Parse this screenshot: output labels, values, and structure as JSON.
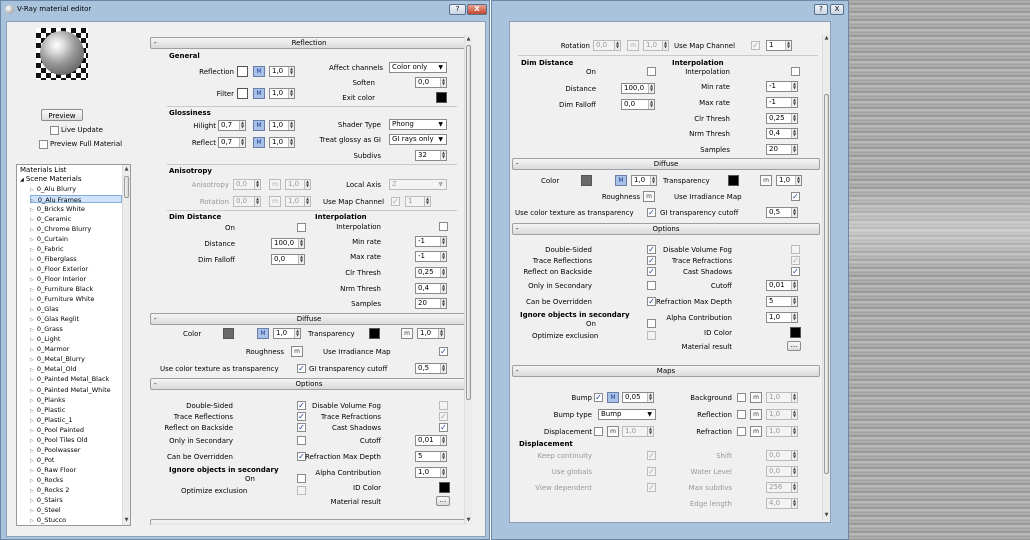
{
  "window1": {
    "title": "V-Ray material editor",
    "help_btn": "?",
    "close_btn": "X",
    "preview_btn": "Preview",
    "live_update": "Live Update",
    "preview_full": "Preview Full Material",
    "materials_list_label": "Materials List",
    "scene_materials": "Scene Materials",
    "materials": [
      "0_Alu Blurry",
      "0_Alu Frames",
      "0_Bricks White",
      "0_Ceramic",
      "0_Chrome Blurry",
      "0_Curtain",
      "0_Fabric",
      "0_Fiberglass",
      "0_Floor Exterior",
      "0_Floor Interior",
      "0_Furniture Black",
      "0_Furniture White",
      "0_Glas",
      "0_Glas Reglit",
      "0_Grass",
      "0_Light",
      "0_Marmor",
      "0_Metal_Blurry",
      "0_Metal_Old",
      "0_Painted Metal_Black",
      "0_Painted Metal_White",
      "0_Planks",
      "0_Plastic",
      "0_Plastic_1",
      "0_Pool Painted",
      "0_Pool Tiles Old",
      "0_Poolwasser",
      "0_Pot",
      "0_Raw Floor",
      "0_Rocks",
      "0_Rocks 2",
      "0_Stairs",
      "0_Steel",
      "0_Stucco"
    ],
    "selected_material": "0_Alu Frames",
    "reflection": {
      "header": "Reflection",
      "general": "General",
      "reflection_lbl": "Reflection",
      "m": "M",
      "reflection_val": "1,0",
      "filter_lbl": "Filter",
      "filter_val": "1,0",
      "affect_channels_lbl": "Affect channels",
      "affect_channels_val": "Color only",
      "soften_lbl": "Soften",
      "soften_val": "0,0",
      "exit_color_lbl": "Exit color",
      "glossiness": "Glossiness",
      "hilight_lbl": "Hilight",
      "hilight_val": "0,7",
      "hilight_mult": "1,0",
      "reflect_lbl": "Reflect",
      "reflect_val": "0,7",
      "reflect_mult": "1,0",
      "shader_type_lbl": "Shader Type",
      "shader_type_val": "Phong",
      "treat_glossy_lbl": "Treat glossy as GI",
      "treat_glossy_val": "GI rays only",
      "subdivs_lbl": "Subdivs",
      "subdivs_val": "32",
      "anisotropy": "Anisotropy",
      "anisotropy_lbl": "Anisotropy",
      "anisotropy_val": "0,0",
      "m_small": "m",
      "anisotropy_mult": "1,0",
      "local_axis_lbl": "Local Axis",
      "local_axis_val": "Z",
      "rotation_lbl": "Rotation",
      "rotation_val": "0,0",
      "rotation_mult": "1,0",
      "use_map_channel_lbl": "Use Map Channel",
      "use_map_channel_val": "1",
      "dim_distance": "Dim Distance",
      "on_lbl": "On",
      "distance_lbl": "Distance",
      "distance_val": "100,0",
      "dim_falloff_lbl": "Dim Falloff",
      "dim_falloff_val": "0,0",
      "interpolation": "Interpolation",
      "interp_lbl": "Interpolation",
      "min_rate_lbl": "Min rate",
      "min_rate_val": "-1",
      "max_rate_lbl": "Max rate",
      "max_rate_val": "-1",
      "clr_thresh_lbl": "Clr Thresh",
      "clr_thresh_val": "0,25",
      "nrm_thresh_lbl": "Nrm Thresh",
      "nrm_thresh_val": "0,4",
      "samples_lbl": "Samples",
      "samples_val": "20"
    },
    "diffuse": {
      "header": "Diffuse",
      "color_lbl": "Color",
      "m": "M",
      "color_val": "1,0",
      "transparency_lbl": "Transparency",
      "m_small": "m",
      "transparency_val": "1,0",
      "roughness_lbl": "Roughness",
      "use_irradiance_lbl": "Use Irradiance Map",
      "use_color_tex_lbl": "Use color texture as transparency",
      "gi_transp_lbl": "GI transparency cutoff",
      "gi_transp_val": "0,5"
    },
    "options": {
      "header": "Options",
      "double_sided": "Double-Sided",
      "trace_reflections": "Trace Reflections",
      "reflect_on_backside": "Reflect on Backside",
      "only_in_secondary": "Only in Secondary",
      "can_be_overridden": "Can be Overridden",
      "disable_volume_fog": "Disable Volume Fog",
      "trace_refractions": "Trace Refractions",
      "cast_shadows": "Cast Shadows",
      "cutoff_lbl": "Cutoff",
      "cutoff_val": "0,01",
      "refraction_max_depth_lbl": "Refraction Max Depth",
      "refraction_max_depth_val": "5",
      "ignore_objects": "Ignore objects in secondary",
      "on_lbl": "On",
      "optimize_exclusion": "Optimize exclusion",
      "alpha_contribution_lbl": "Alpha Contribution",
      "alpha_contribution_val": "1,0",
      "id_color_lbl": "ID Color",
      "material_result_lbl": "Material result",
      "dots": "..."
    }
  },
  "window2": {
    "help_btn": "?",
    "close_btn": "X",
    "rotation_lbl": "Rotation",
    "rotation_val": "0,0",
    "m_small": "m",
    "rotation_mult": "1,0",
    "use_map_channel_lbl": "Use Map Channel",
    "use_map_channel_val": "1",
    "dim_distance": "Dim Distance",
    "on_lbl": "On",
    "distance_lbl": "Distance",
    "distance_val": "100,0",
    "dim_falloff_lbl": "Dim Falloff",
    "dim_falloff_val": "0,0",
    "interpolation": "Interpolation",
    "interp_lbl": "Interpolation",
    "min_rate_lbl": "Min rate",
    "min_rate_val": "-1",
    "max_rate_lbl": "Max rate",
    "max_rate_val": "-1",
    "clr_thresh_lbl": "Clr Thresh",
    "clr_thresh_val": "0,25",
    "nrm_thresh_lbl": "Nrm Thresh",
    "nrm_thresh_val": "0,4",
    "samples_lbl": "Samples",
    "samples_val": "20",
    "diffuse_header": "Diffuse",
    "color_lbl": "Color",
    "m": "M",
    "color_val": "1,0",
    "transparency_lbl": "Transparency",
    "transparency_val": "1,0",
    "roughness_lbl": "Roughness",
    "use_irradiance_lbl": "Use Irradiance Map",
    "use_color_tex_lbl": "Use color texture as transparency",
    "gi_transp_lbl": "GI transparency cutoff",
    "gi_transp_val": "0,5",
    "options_header": "Options",
    "double_sided": "Double-Sided",
    "trace_reflections": "Trace Reflections",
    "reflect_on_backside": "Reflect on Backside",
    "only_in_secondary": "Only in Secondary",
    "can_be_overridden": "Can be Overridden",
    "disable_volume_fog": "Disable Volume Fog",
    "trace_refractions": "Trace Refractions",
    "cast_shadows": "Cast Shadows",
    "cutoff_lbl": "Cutoff",
    "cutoff_val": "0,01",
    "refraction_max_depth_lbl": "Refraction Max Depth",
    "refraction_max_depth_val": "5",
    "ignore_objects": "Ignore objects in secondary",
    "optimize_exclusion": "Optimize exclusion",
    "alpha_contribution_lbl": "Alpha Contribution",
    "alpha_contribution_val": "1,0",
    "id_color_lbl": "ID Color",
    "material_result_lbl": "Material result",
    "dots": "...",
    "maps_header": "Maps",
    "bump_lbl": "Bump",
    "bump_val": "0,05",
    "bump_type_lbl": "Bump type",
    "bump_type_val": "Bump",
    "displacement_lbl": "Displacement",
    "displacement_val": "1,0",
    "background_lbl": "Background",
    "background_val": "1,0",
    "reflection_lbl": "Reflection",
    "reflection_val": "1,0",
    "refraction_lbl": "Refraction",
    "refraction_val": "1,0",
    "displacement_group": "Displacement",
    "keep_continuity": "Keep continuity",
    "use_globals": "Use globals",
    "view_dependent": "View dependent",
    "shift_lbl": "Shift",
    "shift_val": "0,0",
    "water_level_lbl": "Water Level",
    "water_level_val": "0,0",
    "max_subdivs_lbl": "Max subdivs",
    "max_subdivs_val": "256",
    "edge_length_lbl": "Edge length",
    "edge_length_val": "4,0"
  }
}
